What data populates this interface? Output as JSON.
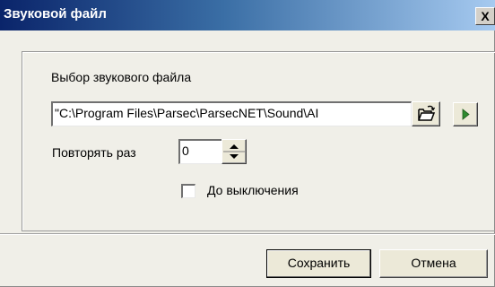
{
  "window": {
    "title": "Звуковой файл",
    "close_label": "X"
  },
  "file": {
    "label": "Выбор звукового файла",
    "path": "\"C:\\Program Files\\Parsec\\ParsecNET\\Sound\\AI",
    "browse_icon": "folder-open-icon",
    "play_icon": "play-icon"
  },
  "repeat": {
    "label": "Повторять раз",
    "value": "0"
  },
  "until_off": {
    "label": "До выключения",
    "checked": false
  },
  "footer": {
    "save_label": "Сохранить",
    "cancel_label": "Отмена"
  },
  "colors": {
    "title_start": "#0a246a",
    "title_end": "#a6caf0",
    "face": "#f0efe8",
    "play": "#2e8a2e"
  }
}
